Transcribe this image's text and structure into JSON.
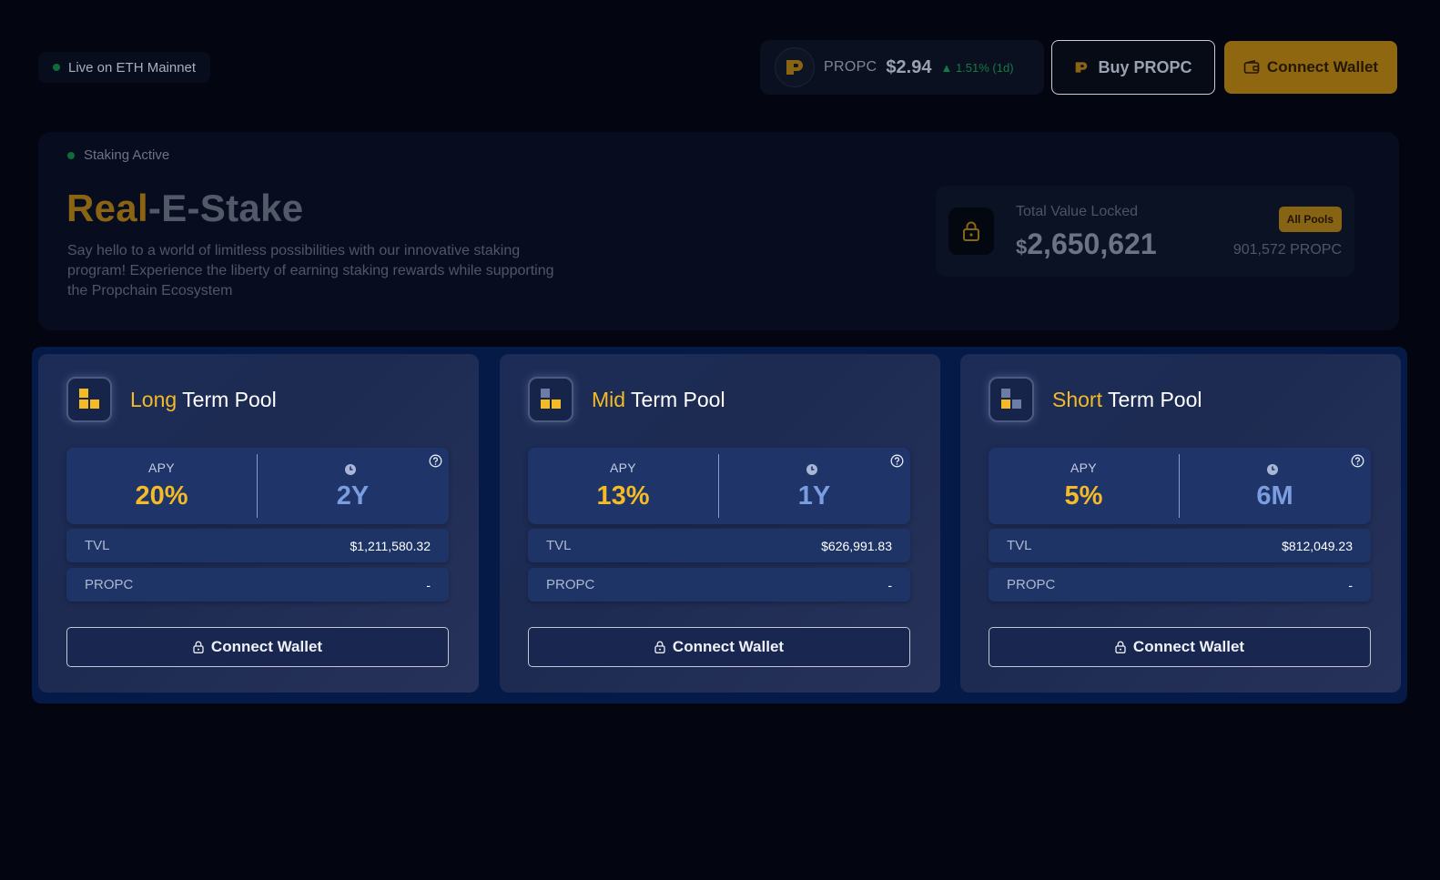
{
  "header": {
    "network_badge": "Live on ETH Mainnet",
    "token": {
      "symbol": "PROPC",
      "price": "$2.94",
      "change": "▲ 1.51% (1d)"
    },
    "buy_label": "Buy PROPC",
    "connect_label": "Connect Wallet"
  },
  "hero": {
    "status": "Staking Active",
    "title_accent": "Real",
    "title_rest": "-E-Stake",
    "description": "Say hello to a world of limitless possibilities with our innovative staking program! Experience the liberty of earning staking rewards while supporting the Propchain Ecosystem",
    "tvl": {
      "label": "Total Value Locked",
      "currency": "$",
      "amount": "2,650,621",
      "badge": "All Pools",
      "propc": "901,572 PROPC"
    }
  },
  "pools": [
    {
      "title_highlight": "Long",
      "title_rest": " Term Pool",
      "apy_label": "APY",
      "apy": "20%",
      "duration": "2Y",
      "tvl_label": "TVL",
      "tvl": "$1,211,580.32",
      "propc_label": "PROPC",
      "propc": "-",
      "button": "Connect Wallet"
    },
    {
      "title_highlight": "Mid",
      "title_rest": " Term Pool",
      "apy_label": "APY",
      "apy": "13%",
      "duration": "1Y",
      "tvl_label": "TVL",
      "tvl": "$626,991.83",
      "propc_label": "PROPC",
      "propc": "-",
      "button": "Connect Wallet"
    },
    {
      "title_highlight": "Short",
      "title_rest": " Term Pool",
      "apy_label": "APY",
      "apy": "5%",
      "duration": "6M",
      "tvl_label": "TVL",
      "tvl": "$812,049.23",
      "propc_label": "PROPC",
      "propc": "-",
      "button": "Connect Wallet"
    }
  ],
  "colors": {
    "accent_gold": "#f4bb27",
    "pool_card": "#1d2b52",
    "status_green": "#0f6b3a",
    "duration_blue": "#7a9de0"
  },
  "icons": [
    "status-dot-icon",
    "propc-logo-icon",
    "wallet-icon",
    "lock-icon",
    "clock-icon",
    "help-icon",
    "pool-blocks-icon"
  ]
}
